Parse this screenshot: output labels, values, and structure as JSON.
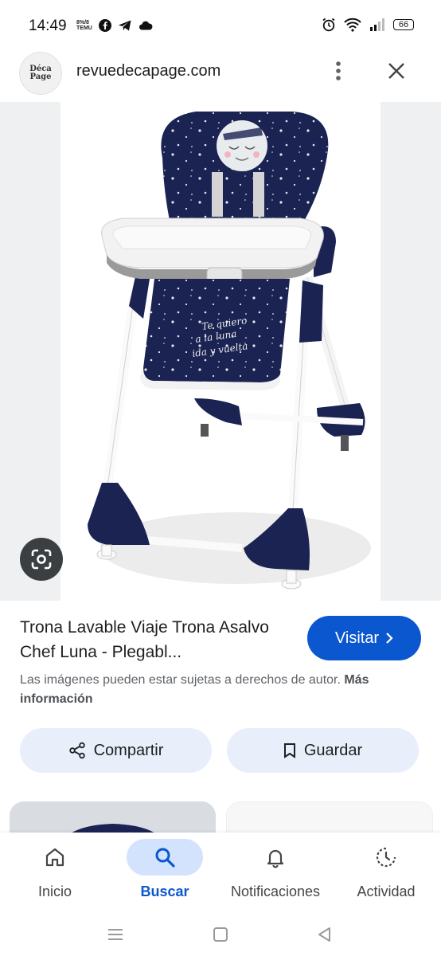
{
  "status_bar": {
    "time": "14:49",
    "small_icon_text": "8%/8 TEMU",
    "battery": "66"
  },
  "header": {
    "logo_line1": "Déca",
    "logo_line2": "Page",
    "site": "revuedecapage.com"
  },
  "product": {
    "print_line1": "Te quiero",
    "print_line2": "a la luna",
    "print_line3": "ida y vuelta"
  },
  "result": {
    "title": "Trona Lavable Viaje Trona Asalvo Chef Luna - Plegabl...",
    "visit_label": "Visitar",
    "copyright_text": "Las imágenes pueden estar sujetas a derechos de autor.",
    "more_info": "Más información"
  },
  "actions": {
    "share_label": "Compartir",
    "save_label": "Guardar"
  },
  "bottom_nav": {
    "items": [
      {
        "label": "Inicio",
        "icon": "home-icon"
      },
      {
        "label": "Buscar",
        "icon": "search-icon",
        "active": true
      },
      {
        "label": "Notificaciones",
        "icon": "bell-icon"
      },
      {
        "label": "Actividad",
        "icon": "activity-icon"
      }
    ]
  },
  "colors": {
    "accent": "#0b57d0",
    "accent_light": "#d3e3fd",
    "chip_bg": "#e8effb",
    "seat_navy": "#1a2352"
  }
}
